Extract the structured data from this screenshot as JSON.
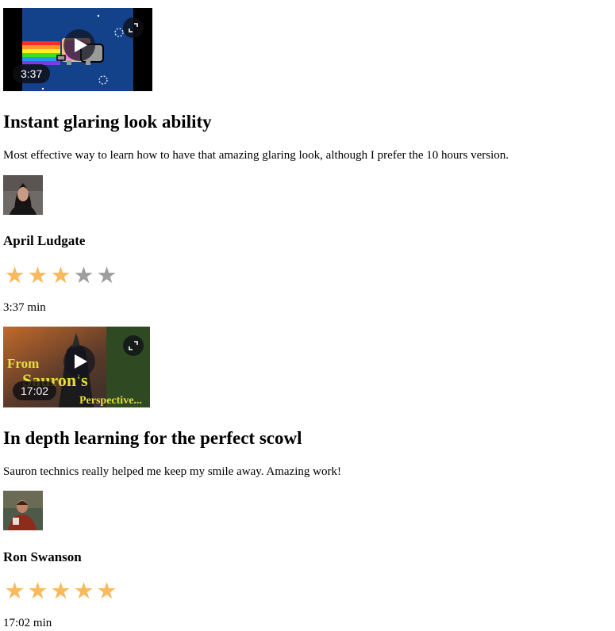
{
  "theme": {
    "star_filled": "#f9b95d",
    "star_empty": "#9e9e9e"
  },
  "videos": [
    {
      "thumbnail": "nyan-cat-thumbnail",
      "duration_badge": "3:37",
      "title": "Instant glaring look ability",
      "description": "Most effective way to learn how to have that amazing glaring look, although I prefer the 10 hours version.",
      "author": "April Ludgate",
      "rating": 3,
      "max_rating": 5,
      "length": "3:37 min"
    },
    {
      "thumbnail": "sauron-thumbnail",
      "thumbnail_text": [
        "From",
        "Sauron's",
        "Perspective..."
      ],
      "duration_badge": "17:02",
      "title": "In depth learning for the perfect scowl",
      "description": "Sauron technics really helped me keep my smile away. Amazing work!",
      "author": "Ron Swanson",
      "rating": 5,
      "max_rating": 5,
      "length": "17:02 min"
    }
  ]
}
